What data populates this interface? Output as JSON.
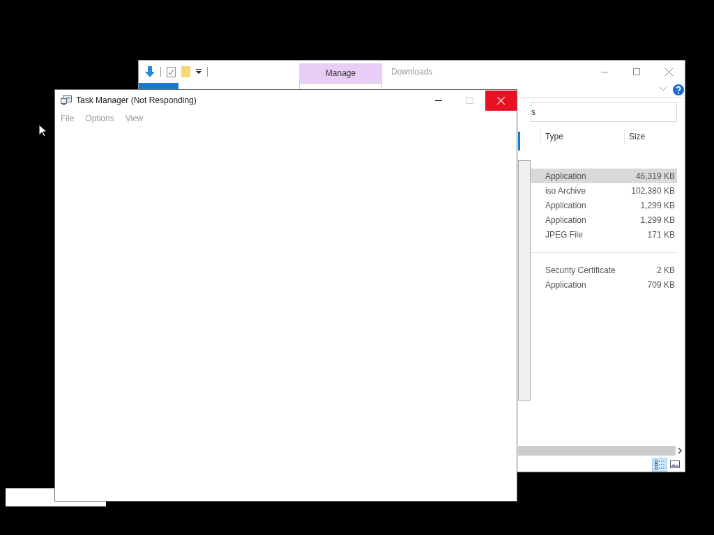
{
  "explorer": {
    "context_tab": "Manage",
    "title": "Downloads",
    "search": {
      "value": "s"
    },
    "columns": [
      "Type",
      "Size"
    ],
    "groups": [
      {
        "rows": [
          {
            "type": "Application",
            "size": "46,319 KB",
            "selected": true
          },
          {
            "type": "iso Archive",
            "size": "102,380 KB",
            "selected": false
          },
          {
            "type": "Application",
            "size": "1,299 KB",
            "selected": false
          },
          {
            "type": "Application",
            "size": "1,299 KB",
            "selected": false
          },
          {
            "type": "JPEG File",
            "size": "171 KB",
            "selected": false
          }
        ]
      },
      {
        "rows": [
          {
            "type": "Security Certificate",
            "size": "2 KB",
            "selected": false
          },
          {
            "type": "Application",
            "size": "709 KB",
            "selected": false
          }
        ]
      }
    ],
    "views": [
      {
        "kind": "details",
        "selected": true
      },
      {
        "kind": "preview",
        "selected": false
      }
    ]
  },
  "task_manager": {
    "title": "Task Manager (Not Responding)",
    "menu": [
      "File",
      "Options",
      "View"
    ]
  }
}
